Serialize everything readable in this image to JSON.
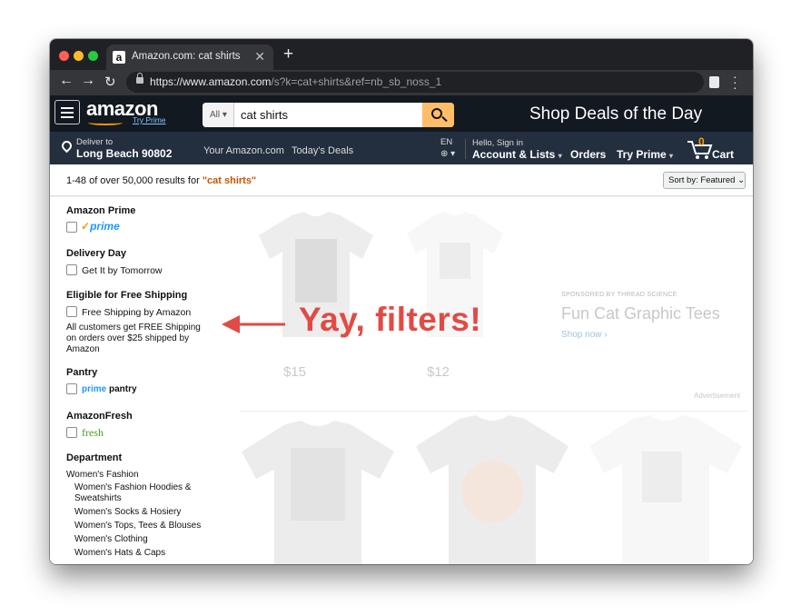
{
  "browser": {
    "tab_title": "Amazon.com: cat shirts",
    "tab_favicon": "a",
    "url_domain": "https://www.amazon.com",
    "url_rest": "/s?k=cat+shirts&ref=nb_sb_noss_1"
  },
  "header": {
    "logo": "amazon",
    "try_prime": "Try Prime",
    "search_category": "All",
    "search_value": "cat shirts",
    "deals_banner": "Shop Deals of the Day"
  },
  "nav": {
    "deliver_to": "Deliver to",
    "location": "Long Beach 90802",
    "your_amazon": "Your Amazon.com",
    "todays_deals": "Today's Deals",
    "language": "EN",
    "hello": "Hello, Sign in",
    "account": "Account & Lists",
    "orders": "Orders",
    "try_prime": "Try Prime",
    "cart_count": "0",
    "cart": "Cart"
  },
  "results": {
    "summary": "1-48 of over 50,000 results for ",
    "query": "\"cat shirts\"",
    "sort_label": "Sort by:",
    "sort_value": "Featured"
  },
  "sidebar": {
    "amazon_prime": "Amazon Prime",
    "prime_logo": "prime",
    "delivery_day": "Delivery Day",
    "get_it_tomorrow": "Get It by Tomorrow",
    "free_shipping_head": "Eligible for Free Shipping",
    "free_shipping_amazon": "Free Shipping by Amazon",
    "free_shipping_note": "All customers get FREE Shipping on orders over $25 shipped by Amazon",
    "pantry_head": "Pantry",
    "pantry_prime": "prime",
    "pantry_word": "pantry",
    "amazonfresh_head": "AmazonFresh",
    "fresh_logo": "fresh",
    "department_head": "Department",
    "department_main": "Women's Fashion",
    "department_items": [
      "Women's Fashion Hoodies & Sweatshirts",
      "Women's Socks & Hosiery",
      "Women's Tops, Tees & Blouses",
      "Women's Clothing",
      "Women's Hats & Caps"
    ]
  },
  "sponsored": {
    "label": "SPONSORED BY THREAD SCIENCE",
    "title": "Fun Cat Graphic Tees",
    "link": "Shop now ›",
    "price1": "$15",
    "price2": "$12",
    "ad_label": "Advertisement"
  },
  "annotation": {
    "text": "Yay, filters!"
  },
  "colors": {
    "header_bg": "#131921",
    "nav_bg": "#232f3e",
    "search_button": "#febd69",
    "prime_blue": "#1a98ff",
    "query_orange": "#c45500",
    "annotation_red": "#e14b45"
  }
}
